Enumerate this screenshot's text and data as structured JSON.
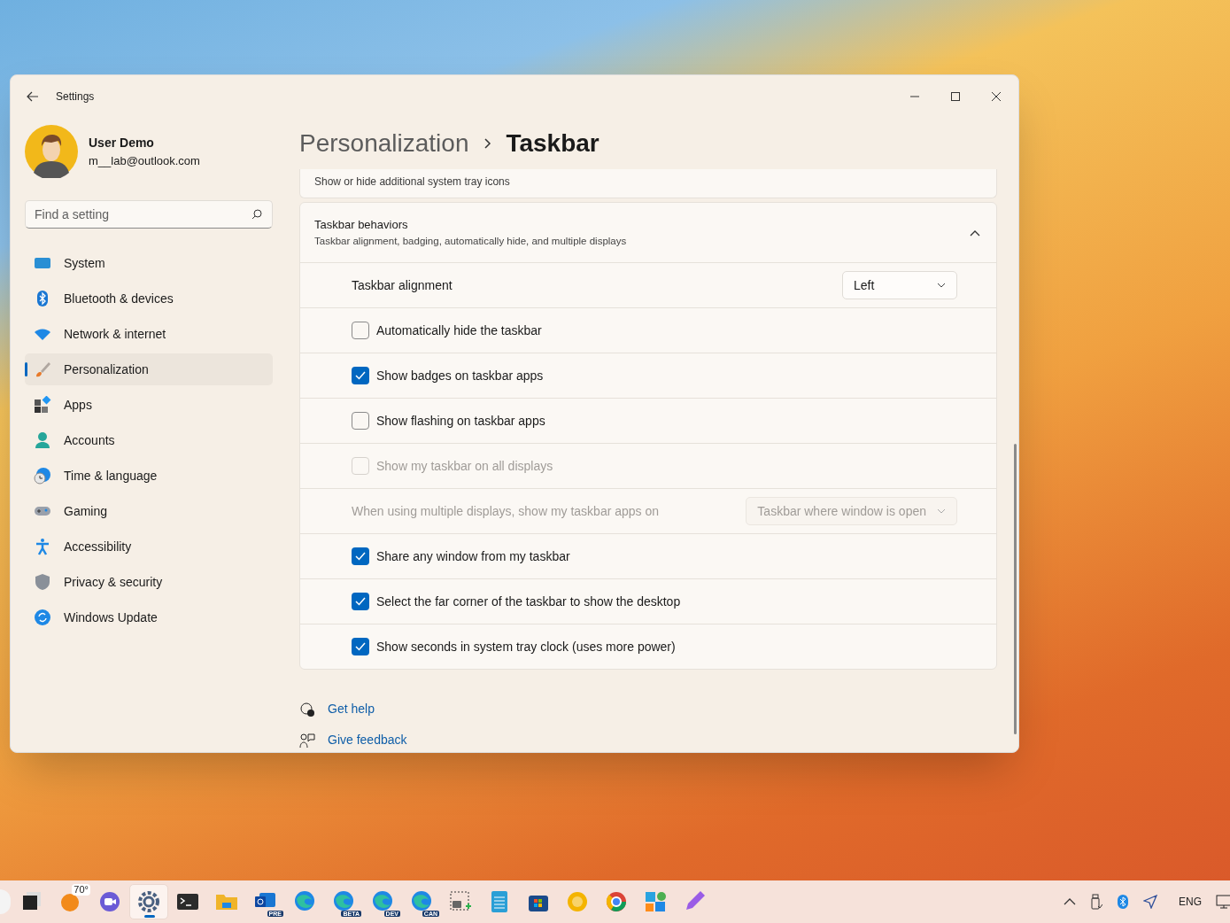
{
  "window": {
    "title": "Settings"
  },
  "account": {
    "name": "User Demo",
    "email": "m__lab@outlook.com"
  },
  "search": {
    "placeholder": "Find a setting"
  },
  "nav": [
    {
      "label": "System",
      "selected": false
    },
    {
      "label": "Bluetooth & devices",
      "selected": false
    },
    {
      "label": "Network & internet",
      "selected": false
    },
    {
      "label": "Personalization",
      "selected": true
    },
    {
      "label": "Apps",
      "selected": false
    },
    {
      "label": "Accounts",
      "selected": false
    },
    {
      "label": "Time & language",
      "selected": false
    },
    {
      "label": "Gaming",
      "selected": false
    },
    {
      "label": "Accessibility",
      "selected": false
    },
    {
      "label": "Privacy & security",
      "selected": false
    },
    {
      "label": "Windows Update",
      "selected": false
    }
  ],
  "breadcrumb": {
    "parent": "Personalization",
    "current": "Taskbar"
  },
  "tray_icons_card": {
    "description": "Show or hide additional system tray icons"
  },
  "behaviors": {
    "title": "Taskbar behaviors",
    "description": "Taskbar alignment, badging, automatically hide, and multiple displays",
    "expanded": true,
    "rows": [
      {
        "kind": "dropdown",
        "label": "Taskbar alignment",
        "value": "Left",
        "disabled": false
      },
      {
        "kind": "checkbox",
        "label": "Automatically hide the taskbar",
        "checked": false,
        "disabled": false
      },
      {
        "kind": "checkbox",
        "label": "Show badges on taskbar apps",
        "checked": true,
        "disabled": false
      },
      {
        "kind": "checkbox",
        "label": "Show flashing on taskbar apps",
        "checked": false,
        "disabled": false
      },
      {
        "kind": "checkbox",
        "label": "Show my taskbar on all displays",
        "checked": false,
        "disabled": true
      },
      {
        "kind": "dropdown",
        "label": "When using multiple displays, show my taskbar apps on",
        "value": "Taskbar where window is open",
        "disabled": true
      },
      {
        "kind": "checkbox",
        "label": "Share any window from my taskbar",
        "checked": true,
        "disabled": false
      },
      {
        "kind": "checkbox",
        "label": "Select the far corner of the taskbar to show the desktop",
        "checked": true,
        "disabled": false
      },
      {
        "kind": "checkbox",
        "label": "Show seconds in system tray clock (uses more power)",
        "checked": true,
        "disabled": false
      }
    ]
  },
  "help_links": [
    {
      "label": "Get help"
    },
    {
      "label": "Give feedback"
    }
  ],
  "taskbar": {
    "apps": [
      {
        "selected": false
      },
      {
        "badge": "70°",
        "selected": false
      },
      {
        "selected": false
      },
      {
        "selected": true
      },
      {
        "selected": false
      },
      {
        "selected": false
      },
      {
        "tag": "PRE",
        "selected": false
      },
      {
        "selected": false
      },
      {
        "tag": "BETA",
        "selected": false
      },
      {
        "tag": "DEV",
        "selected": false
      },
      {
        "tag": "CAN",
        "selected": false
      },
      {
        "selected": false
      },
      {
        "selected": false
      },
      {
        "selected": false
      },
      {
        "selected": false
      },
      {
        "selected": false
      },
      {
        "selected": false
      },
      {
        "selected": false
      }
    ],
    "language": "ENG"
  }
}
